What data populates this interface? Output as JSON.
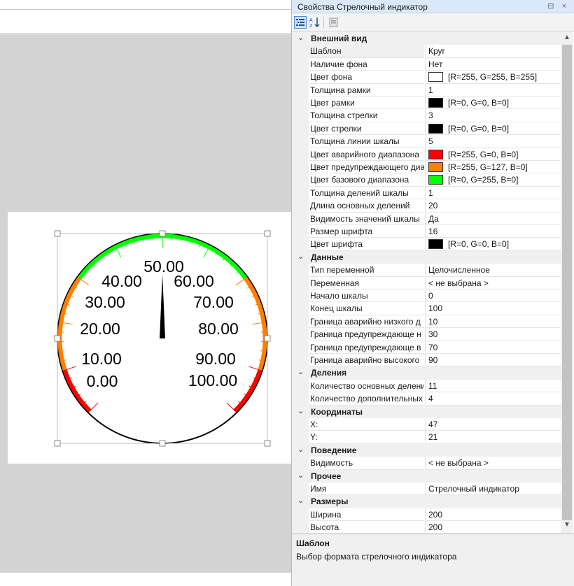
{
  "panel": {
    "title": "Свойства Стрелочный индикатор",
    "title_buttons": "⊟ ×",
    "tools": [
      "categorized-icon",
      "alphabetical-sort-icon",
      "property-pages-icon"
    ]
  },
  "categories": [
    {
      "name": "Внешний вид",
      "props": [
        {
          "name": "Шаблон",
          "value": "Круг"
        },
        {
          "name": "Наличие фона",
          "value": "Нет"
        },
        {
          "name": "Цвет фона",
          "value": "[R=255, G=255, B=255]",
          "color": "#ffffff"
        },
        {
          "name": "Толщина рамки",
          "value": "1"
        },
        {
          "name": "Цвет рамки",
          "value": "[R=0, G=0, B=0]",
          "color": "#000000"
        },
        {
          "name": "Толщина стрелки",
          "value": "3"
        },
        {
          "name": "Цвет стрелки",
          "value": "[R=0, G=0, B=0]",
          "color": "#000000"
        },
        {
          "name": "Толщина линии шкалы",
          "value": "5"
        },
        {
          "name": "Цвет аварийного диапазона",
          "value": "[R=255, G=0, B=0]",
          "color": "#ff0000"
        },
        {
          "name": "Цвет предупреждающего диа",
          "value": "[R=255, G=127, B=0]",
          "color": "#ff7f00"
        },
        {
          "name": "Цвет базового диапазона",
          "value": "[R=0, G=255, B=0]",
          "color": "#00ff00"
        },
        {
          "name": "Толщина делений шкалы",
          "value": "1"
        },
        {
          "name": "Длина основных делений",
          "value": "20"
        },
        {
          "name": "Видимость значений шкалы",
          "value": "Да"
        },
        {
          "name": "Размер шрифта",
          "value": "16"
        },
        {
          "name": "Цвет шрифта",
          "value": "[R=0, G=0, B=0]",
          "color": "#000000"
        }
      ]
    },
    {
      "name": "Данные",
      "props": [
        {
          "name": "Тип переменной",
          "value": "Целочисленное"
        },
        {
          "name": "Переменная",
          "value": "< не выбрана >"
        },
        {
          "name": "Начало шкалы",
          "value": "0"
        },
        {
          "name": "Конец шкалы",
          "value": "100"
        },
        {
          "name": "Граница аварийно низкого д",
          "value": "10"
        },
        {
          "name": "Граница предупреждающе н",
          "value": "30"
        },
        {
          "name": "Граница предупреждающе в",
          "value": "70"
        },
        {
          "name": "Граница аварийно высокого",
          "value": "90"
        }
      ]
    },
    {
      "name": "Деления",
      "props": [
        {
          "name": "Количество основных делени",
          "value": "11"
        },
        {
          "name": "Количество дополнительных",
          "value": "4"
        }
      ]
    },
    {
      "name": "Координаты",
      "props": [
        {
          "name": "X:",
          "value": "47"
        },
        {
          "name": "Y:",
          "value": "21"
        }
      ]
    },
    {
      "name": "Поведение",
      "props": [
        {
          "name": "Видимость",
          "value": "< не выбрана >"
        }
      ]
    },
    {
      "name": "Прочее",
      "props": [
        {
          "name": "Имя",
          "value": "Стрелочный индикатор"
        }
      ]
    },
    {
      "name": "Размеры",
      "props": [
        {
          "name": "Ширина",
          "value": "200"
        },
        {
          "name": "Высота",
          "value": "200"
        }
      ]
    }
  ],
  "description": {
    "title": "Шаблон",
    "text": "Выбор формата стрелочного индикатора"
  },
  "gauge": {
    "scale_labels": [
      "0.00",
      "10.00",
      "20.00",
      "30.00",
      "40.00",
      "50.00",
      "60.00",
      "70.00",
      "80.00",
      "90.00",
      "100.00"
    ],
    "min": 0,
    "max": 100,
    "alarm_low": 10,
    "warn_low": 30,
    "warn_high": 70,
    "alarm_high": 90,
    "needle_value": 50,
    "colors": {
      "alarm": "#ff0000",
      "warning": "#ff7f00",
      "base": "#00ff00",
      "frame": "#000000",
      "needle": "#000000",
      "font": "#000000"
    }
  },
  "colors": {
    "panel_title_bg": "#dbe8f7",
    "canvas_bg": "#d3d3d3",
    "scroll_thumb": "#c2c2c2"
  }
}
